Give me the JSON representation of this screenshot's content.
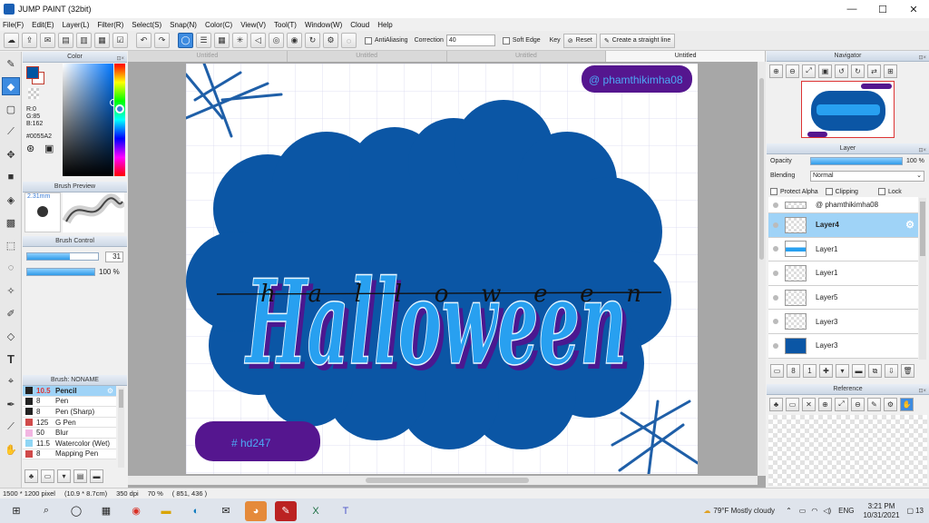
{
  "window": {
    "title": "JUMP PAINT (32bit)",
    "minimize": "—",
    "maximize": "☐",
    "close": "✕"
  },
  "menu": [
    "File(F)",
    "Edit(E)",
    "Layer(L)",
    "Filter(R)",
    "Select(S)",
    "Snap(N)",
    "Color(C)",
    "View(V)",
    "Tool(T)",
    "Window(W)",
    "Cloud",
    "Help"
  ],
  "toolbar": {
    "antialiasing_label": "AntiAliasing",
    "correction_label": "Correction",
    "correction_value": "40",
    "soft_edge_label": "Soft Edge",
    "key_label": "Key",
    "reset_label": "Reset",
    "straight_line_label": "Create a straight line"
  },
  "color_panel": {
    "title": "Color",
    "r": "R:0",
    "g": "G:85",
    "b": "B:162",
    "hex": "#0055A2",
    "primary_color": "#0055A2",
    "secondary_color": "#ffffff"
  },
  "brush_preview": {
    "title": "Brush Preview",
    "size": "2.31mm"
  },
  "brush_control": {
    "title": "Brush Control",
    "size_value": "31",
    "opacity_value": "100 %",
    "size_fill": 0.6,
    "opacity_fill": 1.0
  },
  "brush_list": {
    "title": "Brush: NONAME",
    "items": [
      {
        "size": "10.5",
        "name": "Pencil",
        "color": "#222222",
        "selected": true
      },
      {
        "size": "8",
        "name": "Pen",
        "color": "#222222"
      },
      {
        "size": "8",
        "name": "Pen (Sharp)",
        "color": "#222222"
      },
      {
        "size": "125",
        "name": "G Pen",
        "color": "#d04a4a"
      },
      {
        "size": "50",
        "name": "Blur",
        "color": "#f2b6e2"
      },
      {
        "size": "11.5",
        "name": "Watercolor (Wet)",
        "color": "#8fd6f5"
      },
      {
        "size": "8",
        "name": "Mapping Pen",
        "color": "#d04a4a"
      }
    ]
  },
  "tabs": [
    "Untitled",
    "Untitled",
    "Untitled",
    "Untitled"
  ],
  "artwork": {
    "title_text": "Halloween",
    "script_text": "halloween",
    "watermark_top": "@ phamthikimha08",
    "watermark_bottom": "# hd247",
    "cloud_color": "#0b56a5",
    "letter_color": "#28a0f0",
    "shadow_color": "#4b1890",
    "badge_color": "#55168f"
  },
  "navigator": {
    "title": "Navigator"
  },
  "layer_panel": {
    "title": "Layer",
    "opacity_label": "Opacity",
    "opacity_value": "100 %",
    "opacity_fill": 1.0,
    "blending_label": "Blending",
    "blending_value": "Normal",
    "protect_alpha": "Protect Alpha",
    "clipping": "Clipping",
    "lock": "Lock",
    "layers": [
      {
        "name": "@ phamthikimha08",
        "selected": false
      },
      {
        "name": "Layer4",
        "selected": true
      },
      {
        "name": "Layer1",
        "selected": false
      },
      {
        "name": "Layer1",
        "selected": false
      },
      {
        "name": "Layer5",
        "selected": false
      },
      {
        "name": "Layer3",
        "selected": false
      },
      {
        "name": "Layer3",
        "selected": false
      }
    ]
  },
  "reference": {
    "title": "Reference"
  },
  "status": {
    "dimensions": "1500 * 1200 pixel",
    "size_cm": "(10.9 * 8.7cm)",
    "dpi": "350 dpi",
    "zoom": "70 %",
    "coords": "( 851, 436 )"
  },
  "taskbar": {
    "weather": "79°F  Mostly cloudy",
    "lang": "ENG",
    "time": "3:21 PM",
    "date": "10/31/2021",
    "notifications": "13"
  }
}
